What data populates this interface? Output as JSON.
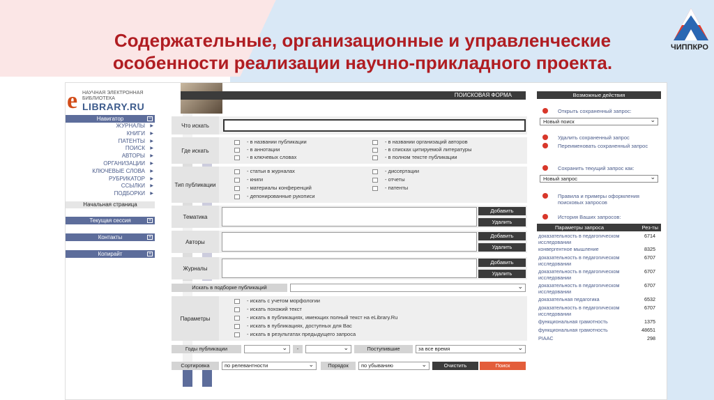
{
  "slide": {
    "title_line1": "Содержательные, организационные и управленческие",
    "title_line2": "особенности реализации научно-прикладного проекта.",
    "logo_text": "ЧИППКРО",
    "accent_color": "#b01d22"
  },
  "brand": {
    "tagline": "НАУЧНАЯ ЭЛЕКТРОННАЯ БИБЛИОТЕКА",
    "name": "LIBRARY.RU",
    "letter": "e"
  },
  "nav": {
    "header": "Навигатор",
    "items": [
      "ЖУРНАЛЫ",
      "КНИГИ",
      "ПАТЕНТЫ",
      "ПОИСК",
      "АВТОРЫ",
      "ОРГАНИЗАЦИИ",
      "КЛЮЧЕВЫЕ СЛОВА",
      "РУБРИКАТОР",
      "ССЫЛКИ",
      "ПОДБОРКИ"
    ],
    "home": "Начальная страница",
    "session": "Текущая сессия",
    "contacts": "Контакты",
    "copyright": "Копирайт"
  },
  "form": {
    "header": "ПОИСКОВАЯ ФОРМА",
    "what_label": "Что искать",
    "where_label": "Где искать",
    "where_opts_left": [
      "- в названии публикации",
      "- в аннотации",
      "- в ключевых словах"
    ],
    "where_opts_right": [
      "- в названии организаций авторов",
      "- в списках цитируемой литературы",
      "- в полном тексте публикации"
    ],
    "type_label": "Тип публикации",
    "type_opts_left": [
      "- статьи в журналах",
      "- книги",
      "- материалы конференций",
      "- депонированные рукописи"
    ],
    "type_opts_right": [
      "- диссертации",
      "- отчеты",
      "- патенты"
    ],
    "topic_label": "Тематика",
    "authors_label": "Авторы",
    "journals_label": "Журналы",
    "add": "Добавить",
    "remove": "Удалить",
    "collection_label": "Искать в подборке публикаций",
    "params_label": "Параметры",
    "params_opts": [
      "- искать с учетом морфологии",
      "- искать похожий текст",
      "- искать в публикациях, имеющих полный текст на eLibrary.Ru",
      "- искать в публикациях, доступных для Вас",
      "- искать в результатах предыдущего запроса"
    ],
    "years_label": "Годы публикации",
    "dash": "-",
    "received_label": "Поступившие",
    "received_value": "за все время",
    "sort_label": "Сортировка",
    "sort_value": "по релевантности",
    "order_label": "Порядок",
    "order_value": "по убыванию",
    "clear": "Очистить",
    "search": "Поиск"
  },
  "right": {
    "header": "Возможные действия",
    "open_saved": "Открыть сохраненный запрос:",
    "new_search": "Новый поиск",
    "delete_saved": "Удалить сохраненный запрос",
    "rename_saved": "Переименовать сохраненный запрос",
    "save_current": "Сохранить текущий запрос как:",
    "new_query": "Новый запрос",
    "rules": "Правила и примеры оформления поисковых запросов",
    "history": "История Ваших запросов:",
    "history_head_params": "Параметры запроса",
    "history_head_res": "Рез-ты",
    "history_rows": [
      {
        "q": "доказательность в педагогическом исследовании",
        "n": "6714"
      },
      {
        "q": "конвергентное мышление",
        "n": "8325"
      },
      {
        "q": "доказательность в педагогическом исследовании",
        "n": "6707"
      },
      {
        "q": "доказательность в педагогическом исследовании",
        "n": "6707"
      },
      {
        "q": "доказательность в педагогическом исследовании",
        "n": "6707"
      },
      {
        "q": "доказательная педагогика",
        "n": "6532"
      },
      {
        "q": "доказательность в педагогическом исследовании",
        "n": "6707"
      },
      {
        "q": "функциональная грамотность",
        "n": "1375"
      },
      {
        "q": "функциональная грамотность",
        "n": "48651"
      },
      {
        "q": "PIAAC",
        "n": "298"
      }
    ]
  }
}
